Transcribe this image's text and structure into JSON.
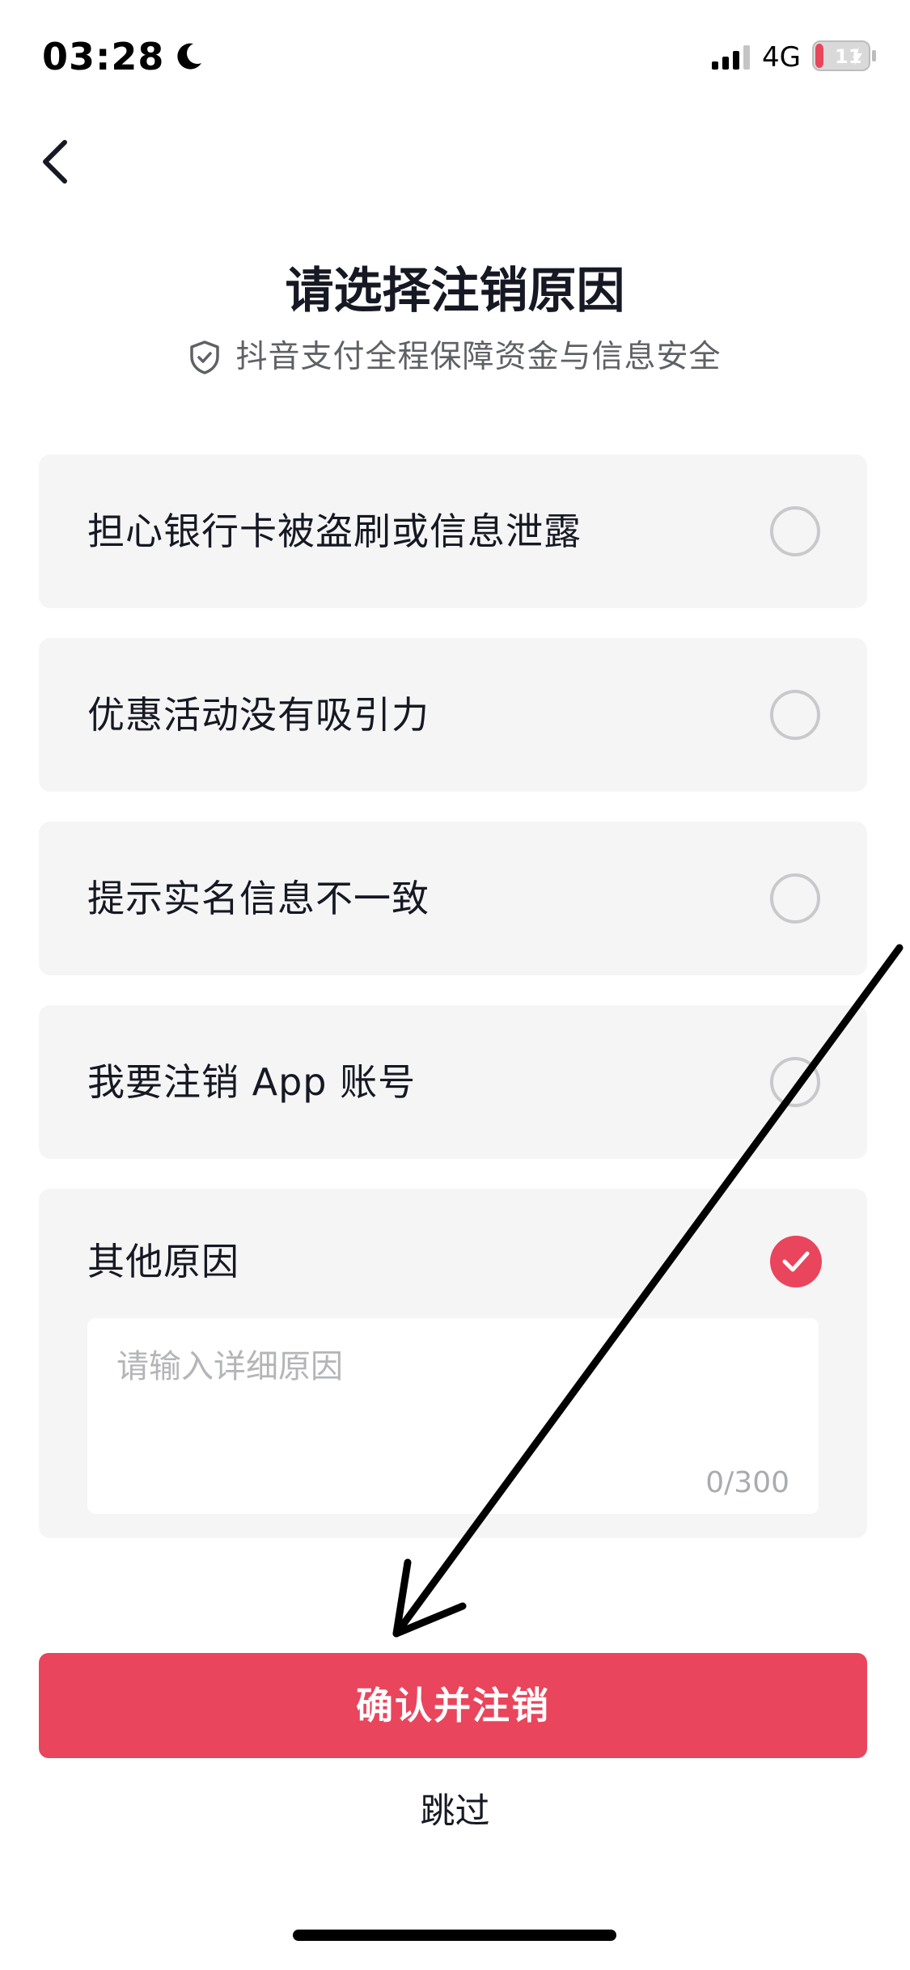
{
  "status_bar": {
    "time": "03:28",
    "network": "4G",
    "battery": "11"
  },
  "header": {
    "title": "请选择注销原因",
    "subtitle": "抖音支付全程保障资金与信息安全"
  },
  "options": [
    {
      "label": "担心银行卡被盗刷或信息泄露",
      "checked": false
    },
    {
      "label": "优惠活动没有吸引力",
      "checked": false
    },
    {
      "label": "提示实名信息不一致",
      "checked": false
    },
    {
      "label": "我要注销 App 账号",
      "checked": false
    },
    {
      "label": "其他原因",
      "checked": true
    }
  ],
  "other_reason": {
    "placeholder": "请输入详细原因",
    "value": "",
    "char_count": "0/300"
  },
  "actions": {
    "confirm_label": "确认并注销",
    "skip_label": "跳过"
  },
  "colors": {
    "accent": "#e9455c",
    "card_bg": "#f5f5f6",
    "text_primary": "#161823",
    "text_secondary": "#5f6166"
  }
}
